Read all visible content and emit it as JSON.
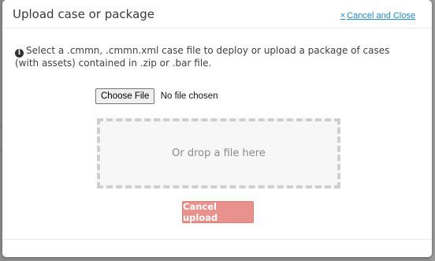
{
  "modal": {
    "title": "Upload case or package",
    "close_x": "×",
    "close_label": "Cancel and Close",
    "info_icon": "i",
    "info_text": "Select a .cmmn, .cmmn.xml case file to deploy or upload a package of cases (with assets) contained in .zip or .bar file.",
    "choose_file_label": "Choose File",
    "no_file_text": "No file chosen",
    "drop_text": "Or drop a file here",
    "cancel_upload_label": "Cancel upload"
  },
  "colors": {
    "link": "#1f8ac7",
    "cancel_button": "#e8918d",
    "backdrop": "#8e8e8e"
  },
  "icons": {
    "info": "info-circle-icon",
    "close": "close-icon"
  }
}
